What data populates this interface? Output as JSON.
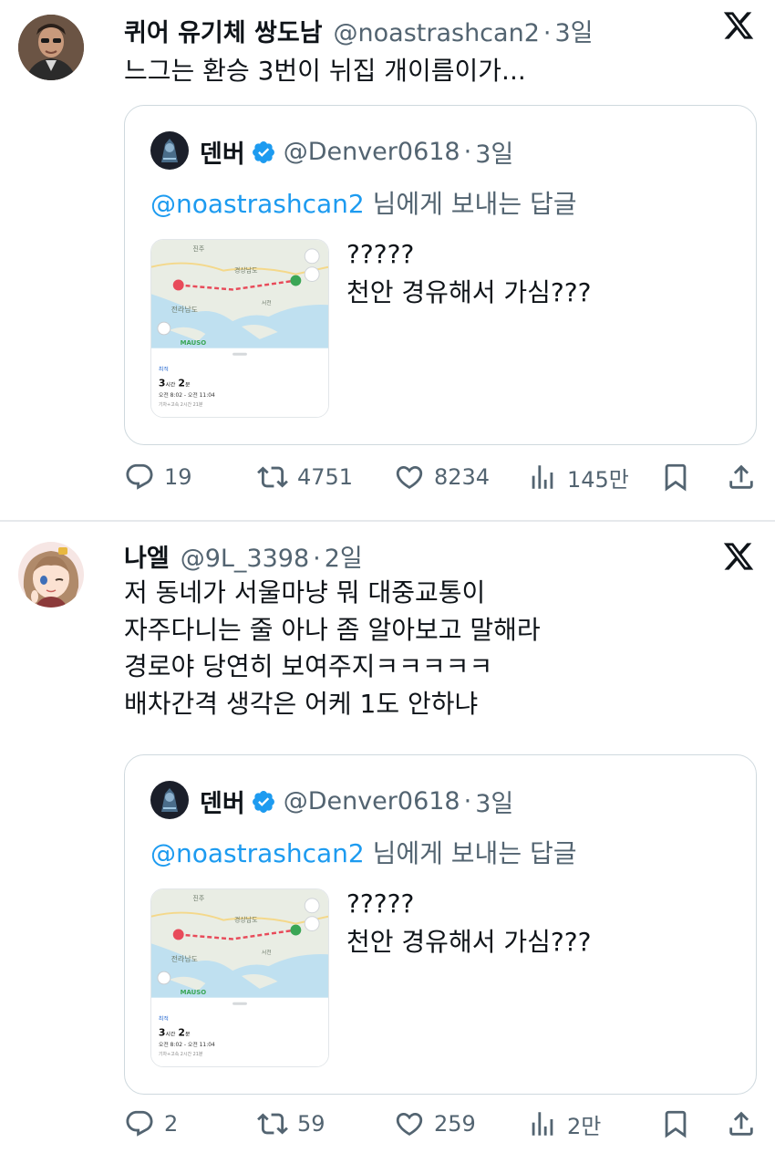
{
  "tweets": [
    {
      "name": "퀴어 유기체 쌍도남",
      "handle": "@noastrashcan2",
      "dot": "·",
      "time": "3일",
      "text": "느그는 환승 3번이 뉘집 개이름이가...",
      "quote": {
        "name": "덴버",
        "handle": "@Denver0618",
        "dot": "·",
        "time": "3일",
        "reply_mention": "@noastrashcan2",
        "reply_suffix": " 님에게 보내는 답글",
        "text": "?????\n천안 경유해서 가심???",
        "map": {
          "region_labels": [
            "전라남도",
            "경상남도",
            "서천",
            "진주"
          ],
          "brand": "MAUSO",
          "badge": "최적",
          "duration_h": "3",
          "duration_h_unit": "시간",
          "duration_m": "2",
          "duration_m_unit": "분",
          "schedule": "오전 8:02 - 오전 11:04",
          "detail": "기차+고속 2시간 21분"
        }
      },
      "actions": {
        "replies": "19",
        "retweets": "4751",
        "likes": "8234",
        "views": "145만"
      }
    },
    {
      "name": "나엘",
      "handle": "@9L_3398",
      "dot": "·",
      "time": "2일",
      "text": "저 동네가 서울마냥 뭐 대중교통이\n자주다니는 줄 아나 좀 알아보고 말해라\n경로야 당연히 보여주지ㅋㅋㅋㅋㅋ\n배차간격 생각은 어케 1도 안하냐",
      "quote": {
        "name": "덴버",
        "handle": "@Denver0618",
        "dot": "·",
        "time": "3일",
        "reply_mention": "@noastrashcan2",
        "reply_suffix": " 님에게 보내는 답글",
        "text": "?????\n천안 경유해서 가심???",
        "map": {
          "region_labels": [
            "전라남도",
            "경상남도",
            "서천",
            "진주"
          ],
          "brand": "MAUSO",
          "badge": "최적",
          "duration_h": "3",
          "duration_h_unit": "시간",
          "duration_m": "2",
          "duration_m_unit": "분",
          "schedule": "오전 8:02 - 오전 11:04",
          "detail": "기차+고속 2시간 21분"
        }
      },
      "actions": {
        "replies": "2",
        "retweets": "59",
        "likes": "259",
        "views": "2만"
      }
    }
  ],
  "colors": {
    "text": "#0f1419",
    "secondary": "#536471",
    "mention": "#1d9bf0",
    "verified": "#1d9bf0",
    "border": "#cfd9de"
  },
  "icons": [
    "x-logo-icon",
    "verified-badge-icon",
    "reply-icon",
    "retweet-icon",
    "like-icon",
    "views-icon",
    "bookmark-icon",
    "share-icon"
  ]
}
